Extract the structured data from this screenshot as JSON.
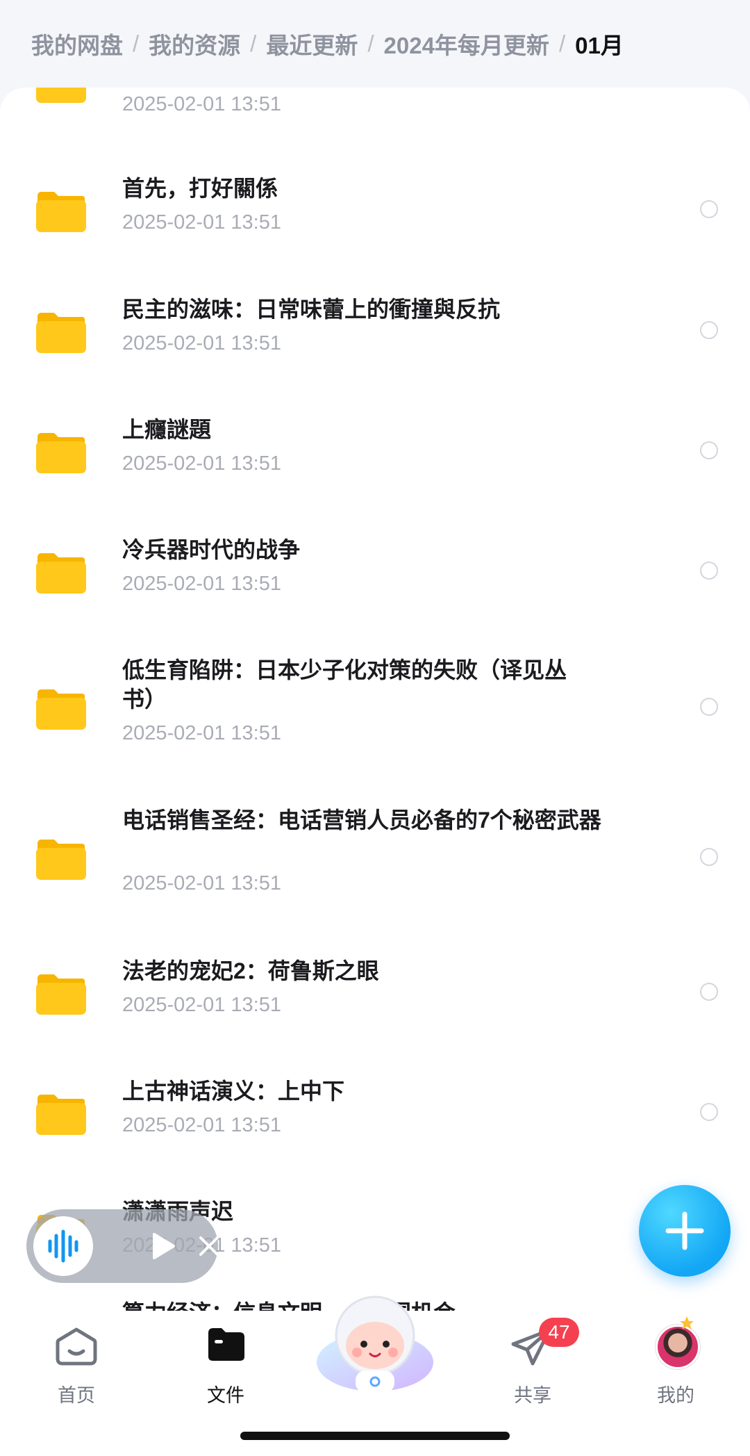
{
  "breadcrumb": {
    "items": [
      "我的网盘",
      "我的资源",
      "最近更新",
      "2024年每月更新"
    ],
    "current": "01月"
  },
  "files": [
    {
      "name": "",
      "date": "2025-02-01 13:51"
    },
    {
      "name": "首先，打好關係",
      "date": "2025-02-01 13:51"
    },
    {
      "name": "民主的滋味：日常味蕾上的衝撞與反抗",
      "date": "2025-02-01 13:51"
    },
    {
      "name": "上癮謎題",
      "date": "2025-02-01 13:51"
    },
    {
      "name": "冷兵器时代的战争",
      "date": "2025-02-01 13:51"
    },
    {
      "name": "低生育陷阱：日本少子化对策的失败（译见丛书）",
      "date": "2025-02-01 13:51"
    },
    {
      "name": "电话销售圣经：电话营销人员必备的7个秘密武器",
      "date": "2025-02-01 13:51"
    },
    {
      "name": "法老的宠妃2：荷鲁斯之眼",
      "date": "2025-02-01 13:51"
    },
    {
      "name": "上古神话演义：上中下",
      "date": "2025-02-01 13:51"
    },
    {
      "name": "潇潇雨声迟",
      "date": "2025-02-01 13:51"
    },
    {
      "name": "算力经济：信息文明……中国机会",
      "date": ""
    }
  ],
  "tabs": [
    {
      "label": "首页",
      "icon": "home-icon"
    },
    {
      "label": "文件",
      "icon": "folder-icon"
    },
    {
      "label": "",
      "icon": "mascot-icon"
    },
    {
      "label": "共享",
      "icon": "send-icon"
    },
    {
      "label": "我的",
      "icon": "avatar"
    }
  ],
  "share_badge": "47",
  "colors": {
    "accent": "#12a6f5",
    "folder": "#ffc81a",
    "badge": "#f5404f"
  }
}
